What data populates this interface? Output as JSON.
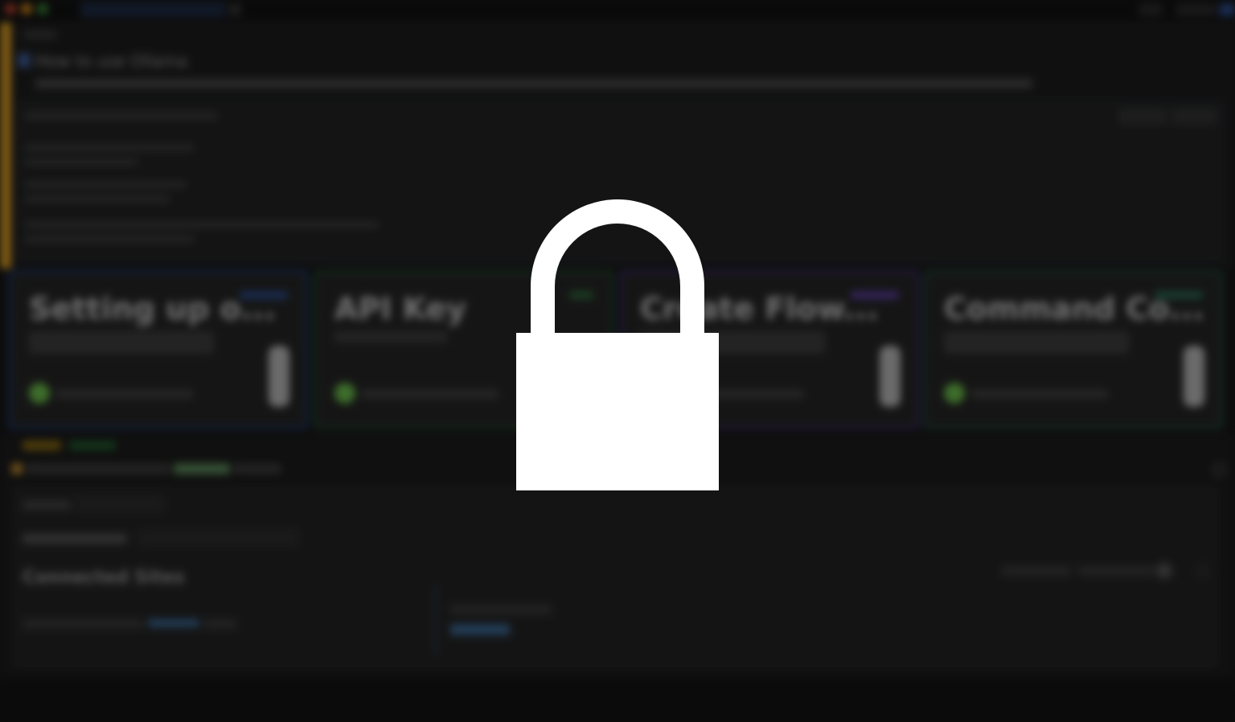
{
  "window": {
    "title": ""
  },
  "document": {
    "title": "How to use Ollama",
    "subtitle": ""
  },
  "cards": [
    {
      "title": "Setting up o...",
      "status": "done",
      "border_color": "#1e3a6e",
      "tag_color": "#2a4c8e"
    },
    {
      "title": "API Key",
      "status": "done",
      "border_color": "#1f4a2b",
      "tag_color": "#2f6a3b"
    },
    {
      "title": "Create Flow...",
      "status": "done",
      "border_color": "#3d2a6e",
      "tag_color": "#5a3e9e"
    },
    {
      "title": "Command Co...",
      "status": "done",
      "border_color": "#1f4a3a",
      "tag_color": "#2a6a52"
    }
  ],
  "lower": {
    "section_title": "Connected Sites"
  },
  "overlay": {
    "icon": "lock-icon",
    "color": "#ffffff"
  },
  "colors": {
    "accent_orange": "#e0a020",
    "check_green": "#6cc24a",
    "background": "#141414"
  }
}
